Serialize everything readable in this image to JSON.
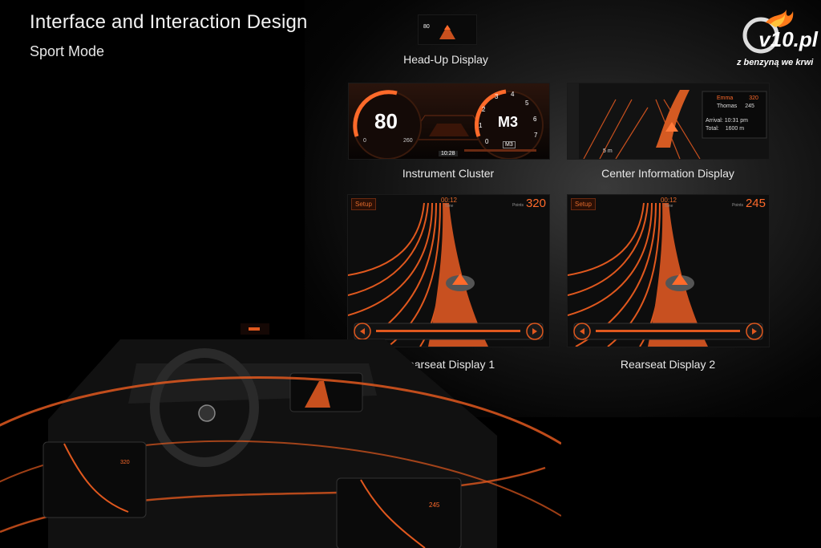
{
  "header": {
    "title": "Interface and Interaction Design",
    "subtitle": "Sport Mode"
  },
  "logo": {
    "text": "v10.pl",
    "tagline": "z benzyną we krwi"
  },
  "displays": {
    "hud": {
      "caption": "Head-Up Display",
      "speed": "80"
    },
    "cluster": {
      "caption": "Instrument Cluster",
      "speed": "80",
      "speed_min": "0",
      "speed_max": "260",
      "gear": "M3",
      "gear_small": "M3",
      "time": "10:28",
      "rpm_ticks": [
        "0",
        "1",
        "2",
        "3",
        "4",
        "5",
        "6",
        "7"
      ]
    },
    "cid": {
      "caption": "Center Information Display",
      "players": [
        {
          "name": "Emma",
          "score": "320"
        },
        {
          "name": "Thomas",
          "score": "245"
        }
      ],
      "arrival_label": "Arrival:",
      "arrival_value": "10:31 pm",
      "total_label": "Total:",
      "total_value": "1600 m",
      "distance": "5 m"
    },
    "rearseat1": {
      "caption": "Rearseat Display 1",
      "setup": "Setup",
      "time": "00:12",
      "time_label": "Time",
      "points_label": "Points",
      "score": "320"
    },
    "rearseat2": {
      "caption": "Rearseat Display 2",
      "setup": "Setup",
      "time": "00:12",
      "time_label": "Time",
      "points_label": "Points",
      "score": "245"
    }
  },
  "interior": {
    "left_tablet_score": "320",
    "right_tablet_score": "245"
  },
  "colors": {
    "accent": "#ff6a2a",
    "background": "#000000"
  }
}
